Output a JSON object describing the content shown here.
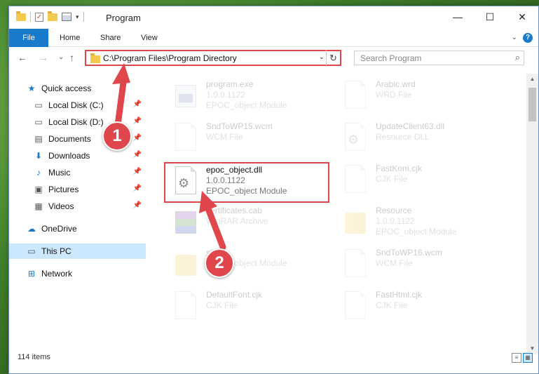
{
  "window": {
    "title": "Program"
  },
  "window_buttons": {
    "minimize": "—",
    "maximize": "☐",
    "close": "✕"
  },
  "ribbon": {
    "tabs": [
      "File",
      "Home",
      "Share",
      "View"
    ],
    "help": "?"
  },
  "address": {
    "path": "C:\\Program Files\\Program Directory",
    "refresh": "↻",
    "dropdown": "⌄"
  },
  "search": {
    "placeholder": "Search Program"
  },
  "nav_arrows": {
    "back": "←",
    "forward": "→",
    "recent": "⌄",
    "up": "↑"
  },
  "sidebar": {
    "items": [
      {
        "label": "Quick access",
        "icon": "star-icon",
        "glyph": "★"
      },
      {
        "label": "Local Disk (C:)",
        "icon": "drive-icon",
        "glyph": "▭",
        "pinned": true
      },
      {
        "label": "Local Disk (D:)",
        "icon": "drive-icon",
        "glyph": "▭",
        "pinned": true
      },
      {
        "label": "Documents",
        "icon": "documents-icon",
        "glyph": "▤",
        "pinned": true
      },
      {
        "label": "Downloads",
        "icon": "downloads-icon",
        "glyph": "⬇",
        "pinned": true
      },
      {
        "label": "Music",
        "icon": "music-icon",
        "glyph": "♪",
        "pinned": true
      },
      {
        "label": "Pictures",
        "icon": "pictures-icon",
        "glyph": "▣",
        "pinned": true
      },
      {
        "label": "Videos",
        "icon": "videos-icon",
        "glyph": "▦",
        "pinned": true
      },
      {
        "label": "OneDrive",
        "icon": "cloud-icon",
        "glyph": "☁"
      },
      {
        "label": "This PC",
        "icon": "computer-icon",
        "glyph": "▭",
        "selected": true
      },
      {
        "label": "Network",
        "icon": "network-icon",
        "glyph": "⊞"
      }
    ],
    "pin_glyph": "📌"
  },
  "files": [
    {
      "name": "program.exe",
      "line2": "1.0.0.1122",
      "line3": "EPOC_object Module",
      "kind": "exe",
      "faded": true
    },
    {
      "name": "Arabic.wrd",
      "line2": "WRD File",
      "line3": "",
      "kind": "page",
      "faded": true
    },
    {
      "name": "SndToWP15.wcm",
      "line2": "WCM File",
      "line3": "",
      "kind": "page",
      "faded": true
    },
    {
      "name": "UpdateClient63.dll",
      "line2": "Resource DLL",
      "line3": "",
      "kind": "gear",
      "faded": true
    },
    {
      "name": "epoc_object.dll",
      "line2": "1.0.0.1122",
      "line3": "EPOC_object Module",
      "kind": "gear",
      "faded": false,
      "highlight": true
    },
    {
      "name": "FastKom.cjk",
      "line2": "CJK File",
      "line3": "",
      "kind": "page",
      "faded": true
    },
    {
      "name": "certificates.cab",
      "line2": "WinRAR Archive",
      "line3": "",
      "kind": "rar",
      "faded": true
    },
    {
      "name": "Resource",
      "line2": "1.0.0.1122",
      "line3": "EPOC_object Module",
      "kind": "folder",
      "faded": true
    },
    {
      "name": "sl4",
      "line2": "",
      "line3": "EPOC_object Module",
      "kind": "folder",
      "faded": true
    },
    {
      "name": "SndToWP16.wcm",
      "line2": "WCM File",
      "line3": "",
      "kind": "page",
      "faded": true
    },
    {
      "name": "DefaultFont.cjk",
      "line2": "CJK File",
      "line3": "",
      "kind": "page",
      "faded": true
    },
    {
      "name": "FastHtml.cjk",
      "line2": "CJK File",
      "line3": "",
      "kind": "page",
      "faded": true
    }
  ],
  "status": {
    "count": "114 items"
  },
  "annotations": {
    "step1": "1",
    "step2": "2",
    "color": "#e0474c"
  }
}
